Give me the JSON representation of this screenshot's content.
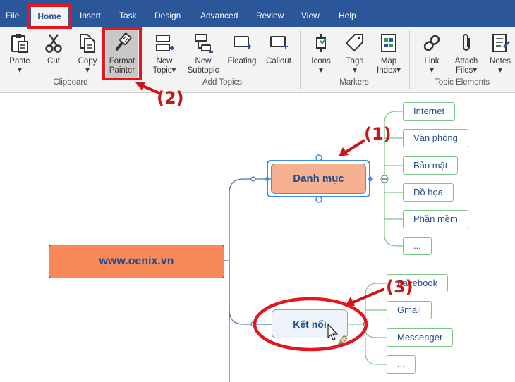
{
  "menu": {
    "items": [
      {
        "label": "File"
      },
      {
        "label": "Home"
      },
      {
        "label": "Insert"
      },
      {
        "label": "Task"
      },
      {
        "label": "Design"
      },
      {
        "label": "Advanced"
      },
      {
        "label": "Review"
      },
      {
        "label": "View"
      },
      {
        "label": "Help"
      }
    ],
    "active": "Home"
  },
  "ribbon": {
    "paste": {
      "label": "Paste",
      "icon": "paste-icon"
    },
    "cut": {
      "label": "Cut",
      "icon": "scissors-icon"
    },
    "copy": {
      "label": "Copy",
      "icon": "copy-icon"
    },
    "format_painter": {
      "line1": "Format",
      "line2": "Painter",
      "icon": "paintbrush-icon"
    },
    "new_topic": {
      "line1": "New",
      "line2": "Topic",
      "icon": "new-topic-icon"
    },
    "new_subtopic": {
      "line1": "New",
      "line2": "Subtopic",
      "icon": "new-subtopic-icon"
    },
    "floating": {
      "label": "Floating",
      "icon": "floating-topic-icon"
    },
    "callout": {
      "label": "Callout",
      "icon": "callout-icon"
    },
    "icons": {
      "label": "Icons",
      "icon": "icons-icon"
    },
    "tags": {
      "label": "Tags",
      "icon": "tag-icon"
    },
    "map_index": {
      "line1": "Map",
      "line2": "Index",
      "icon": "map-index-icon"
    },
    "link": {
      "label": "Link",
      "icon": "link-icon"
    },
    "attach_files": {
      "line1": "Attach",
      "line2": "Files",
      "icon": "paperclip-icon"
    },
    "notes": {
      "label": "Notes",
      "icon": "notes-icon"
    },
    "groups": {
      "clipboard": "Clipboard",
      "add_topics": "Add Topics",
      "markers": "Markers",
      "topic_elements": "Topic Elements"
    }
  },
  "mindmap": {
    "central": "www.oenix.vn",
    "main_topics": [
      {
        "label": "Danh mục",
        "subtopics": [
          "Internet",
          "Văn phòng",
          "Bảo mật",
          "Đồ họa",
          "Phần mềm",
          "..."
        ]
      },
      {
        "label": "Kết nối",
        "subtopics": [
          "Facebook",
          "Gmail",
          "Messenger",
          "..."
        ]
      }
    ]
  },
  "annotations": {
    "a1": "(1)",
    "a2": "(2)",
    "a3": "(3)"
  },
  "colors": {
    "menubar": "#2b579a",
    "highlight": "#e8141b",
    "central_fill": "#f8895a",
    "selected_fill": "#f6b191",
    "branch": "#7cc48c"
  }
}
